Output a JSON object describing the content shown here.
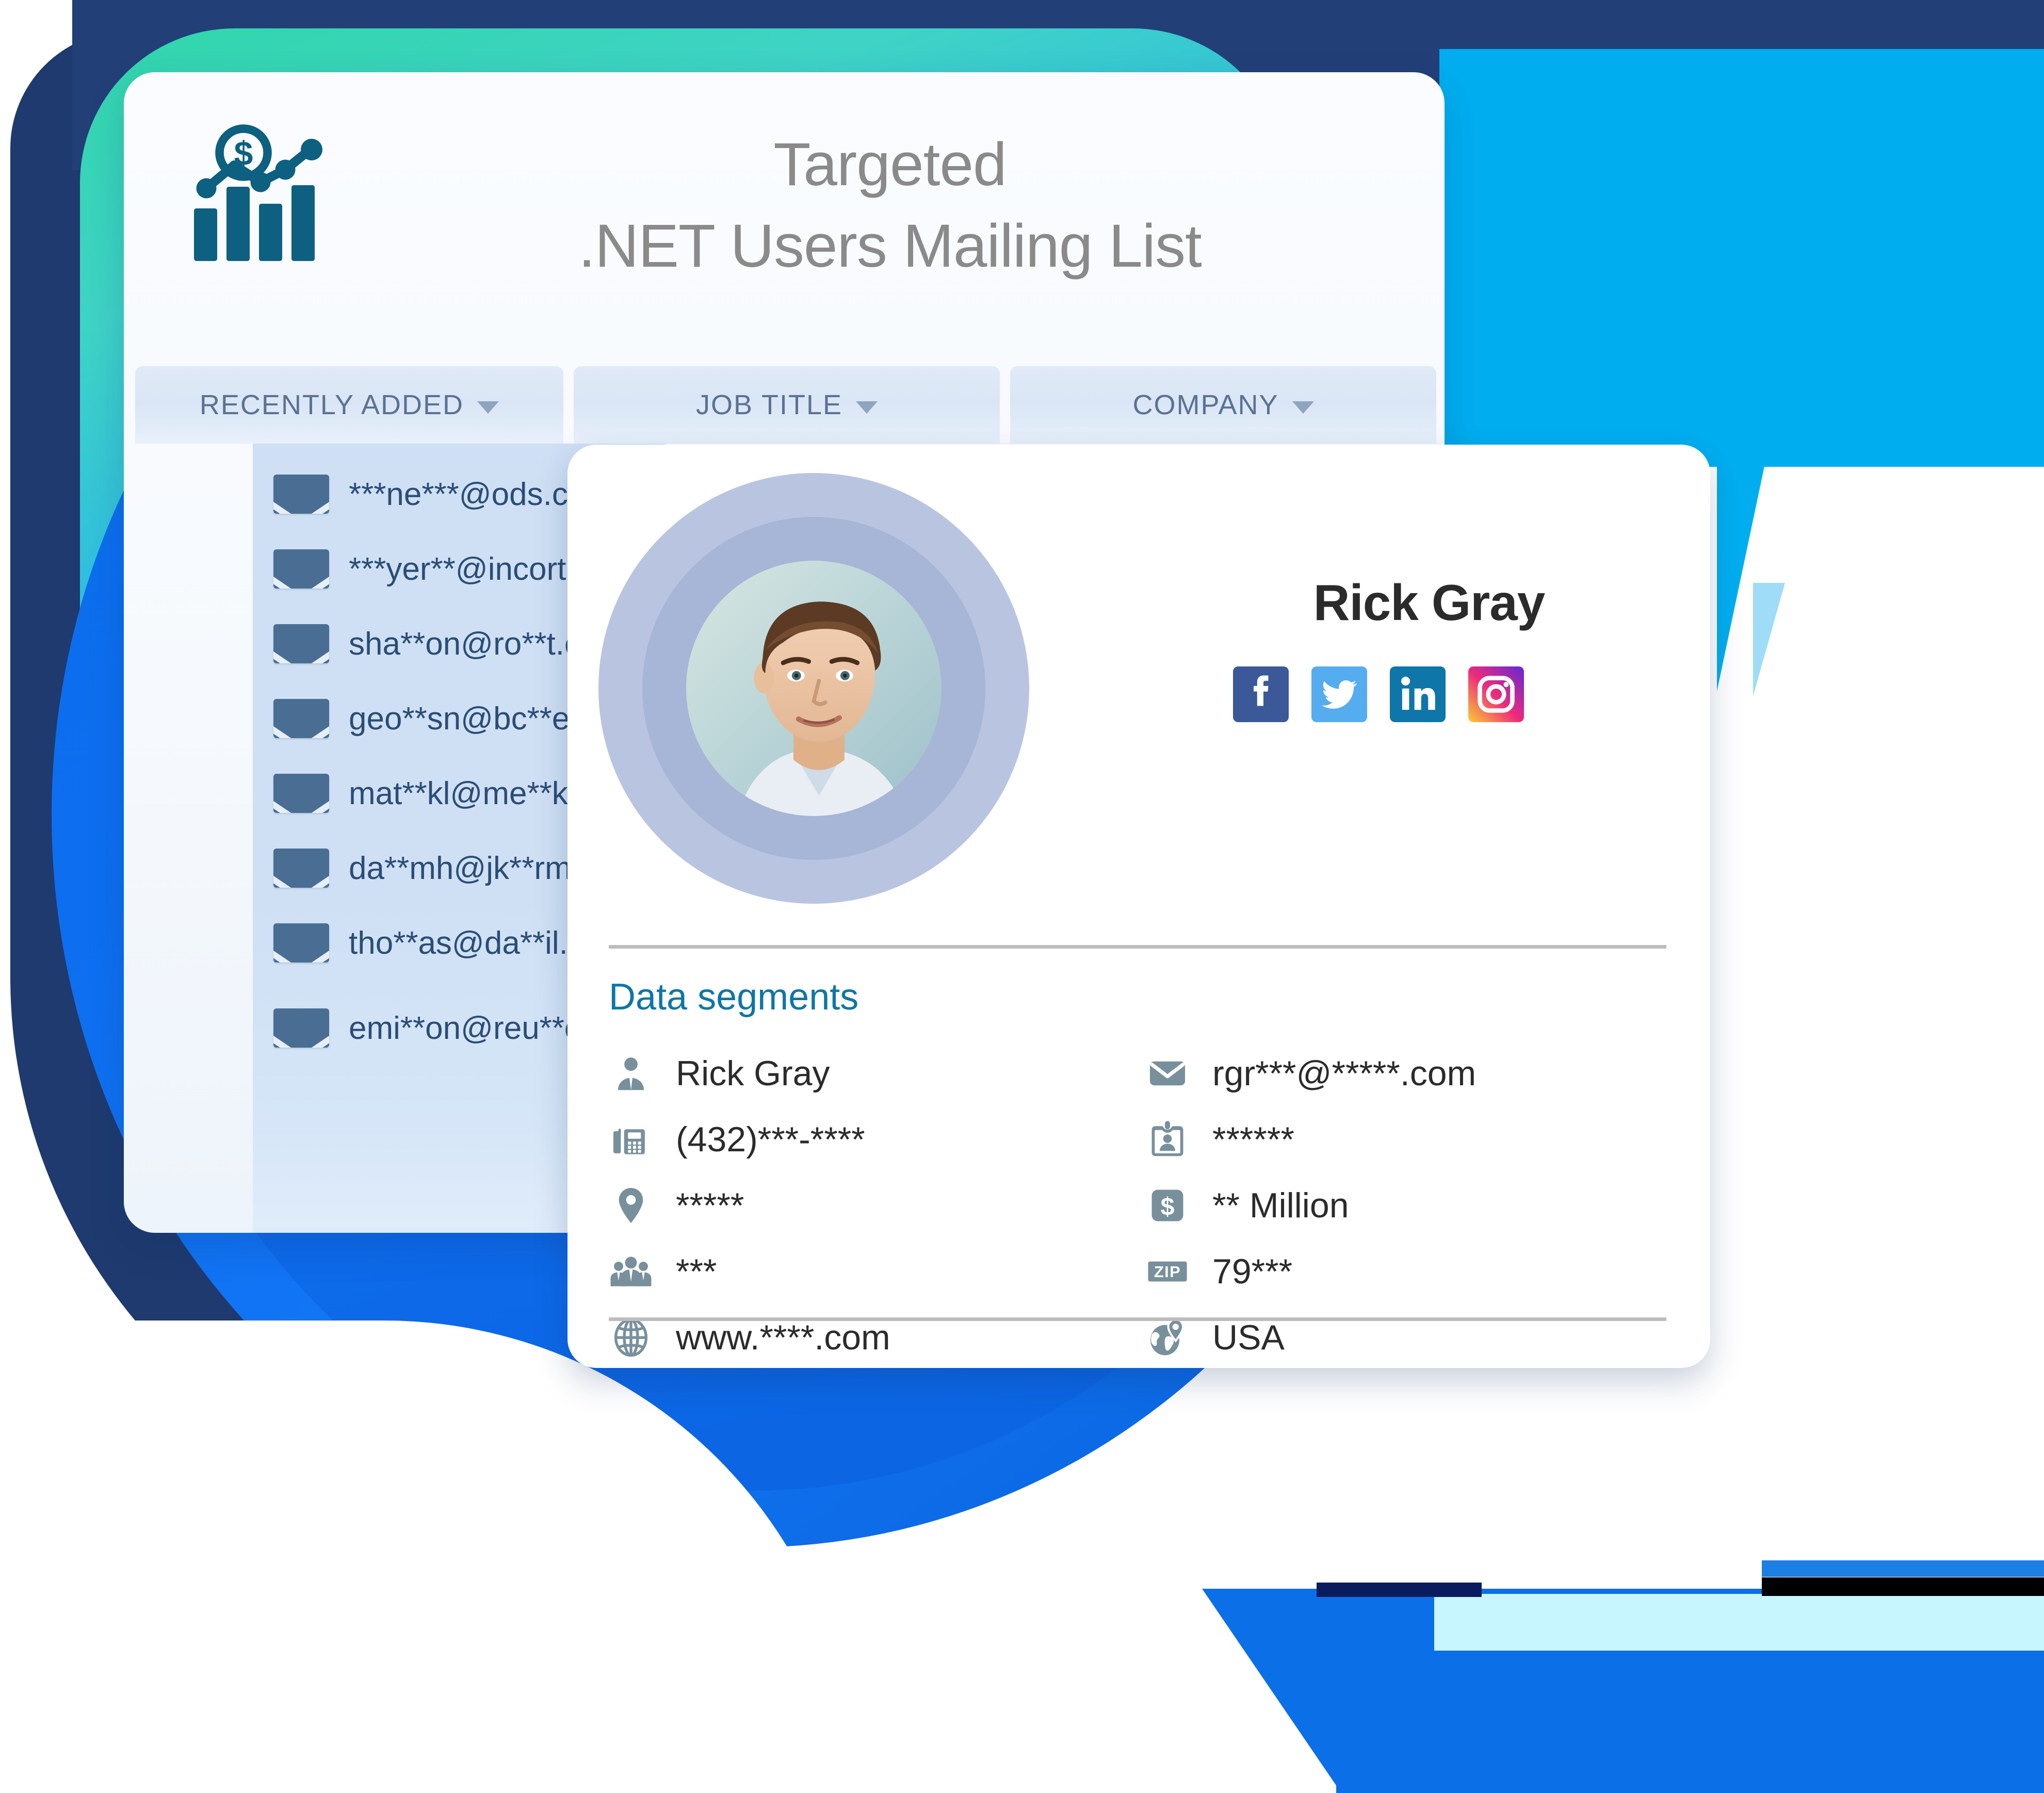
{
  "card": {
    "logo_icon": "bar-chart-dollar-icon",
    "title_line1": "Targeted",
    "title_line2": ".NET Users Mailing List",
    "tabs": [
      {
        "label": "RECENTLY ADDED",
        "icon": "chevron-down-icon"
      },
      {
        "label": "JOB TITLE",
        "icon": "chevron-down-icon"
      },
      {
        "label": "COMPANY",
        "icon": "chevron-down-icon"
      }
    ],
    "emails": [
      {
        "icon": "envelope-icon",
        "address": "***ne***@ods.com"
      },
      {
        "icon": "envelope-icon",
        "address": "***yer**@incorta.com"
      },
      {
        "icon": "envelope-icon",
        "address": "sha**on@ro**t.com"
      },
      {
        "icon": "envelope-icon",
        "address": "geo**sn@bc**el.com"
      },
      {
        "icon": "envelope-icon",
        "address": "mat**kl@me**kc.com"
      },
      {
        "icon": "envelope-icon",
        "address": "da**mh@jk**rm.com"
      },
      {
        "icon": "envelope-icon",
        "address": "tho**as@da**il.com"
      },
      {
        "icon": "envelope-icon",
        "address": "emi**on@reu**ers.com"
      }
    ]
  },
  "profile": {
    "avatar_icon": "user-avatar-photo",
    "name": "Rick Gray",
    "socials": [
      {
        "name": "facebook-icon",
        "label": "Facebook",
        "color": "#3b5998"
      },
      {
        "name": "twitter-icon",
        "label": "Twitter",
        "color": "#55acee"
      },
      {
        "name": "linkedin-icon",
        "label": "LinkedIn",
        "color": "#0e76a8"
      },
      {
        "name": "instagram-icon",
        "label": "Instagram",
        "color": "#ee2a7b"
      }
    ],
    "segments_heading": "Data segments",
    "segments_left": [
      {
        "icon": "person-icon",
        "value": "Rick Gray"
      },
      {
        "icon": "fax-phone-icon",
        "value": "(432)***-****"
      },
      {
        "icon": "location-pin-icon",
        "value": "*****"
      },
      {
        "icon": "people-group-icon",
        "value": "***"
      },
      {
        "icon": "globe-icon",
        "value": "www.****.com"
      }
    ],
    "segments_right": [
      {
        "icon": "email-icon",
        "value": "rgr***@*****.com"
      },
      {
        "icon": "id-badge-icon",
        "value": "******"
      },
      {
        "icon": "dollar-icon",
        "value": "** Million"
      },
      {
        "icon": "zip-icon",
        "value": "79***"
      },
      {
        "icon": "globe-pin-icon",
        "value": "USA"
      }
    ]
  },
  "colors": {
    "navy": "#223f78",
    "teal": "#31d6ab",
    "blue": "#0b6fe8",
    "cyan": "#00aeef",
    "accent_link": "#0d76a8",
    "icon_gray": "#78909c",
    "tab_text": "#5a7293",
    "title_gray": "#8a8a8a",
    "email_text": "#2b4d75"
  }
}
